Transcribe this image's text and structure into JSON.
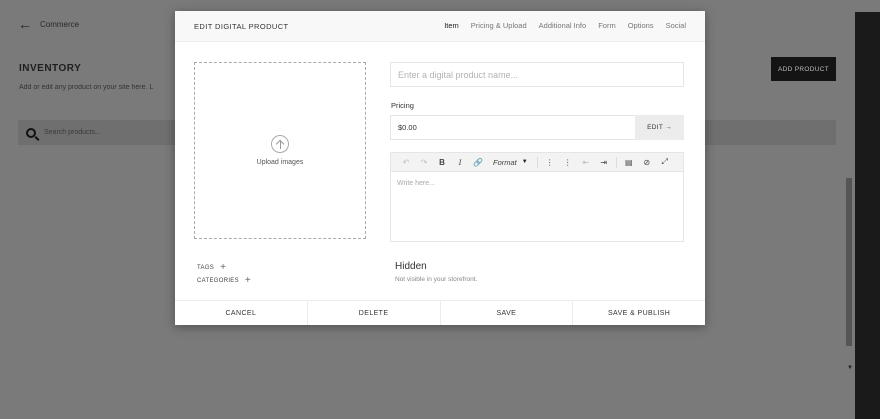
{
  "background": {
    "back_label": "Commerce",
    "title": "INVENTORY",
    "subtitle": "Add or edit any product on your site here. L",
    "search_placeholder": "Search products...",
    "add_button": "ADD PRODUCT"
  },
  "modal": {
    "title": "EDIT DIGITAL PRODUCT",
    "tabs": [
      {
        "label": "Item",
        "active": true
      },
      {
        "label": "Pricing & Upload",
        "active": false
      },
      {
        "label": "Additional Info",
        "active": false
      },
      {
        "label": "Form",
        "active": false
      },
      {
        "label": "Options",
        "active": false
      },
      {
        "label": "Social",
        "active": false
      }
    ],
    "upload_label": "Upload images",
    "name_placeholder": "Enter a digital product name...",
    "pricing_label": "Pricing",
    "price_value": "$0.00",
    "price_edit": "EDIT →",
    "editor": {
      "format_label": "Format",
      "placeholder": "Write here..."
    },
    "tags_label": "TAGS",
    "categories_label": "CATEGORIES",
    "visibility_title": "Hidden",
    "visibility_sub": "Not visible in your storefront.",
    "footer": {
      "cancel": "CANCEL",
      "delete": "DELETE",
      "save": "SAVE",
      "save_publish": "SAVE & PUBLISH"
    }
  },
  "colors": {
    "overlay": "#7a7a7a",
    "modal_bg": "#ffffff",
    "dark_button": "#141414"
  }
}
